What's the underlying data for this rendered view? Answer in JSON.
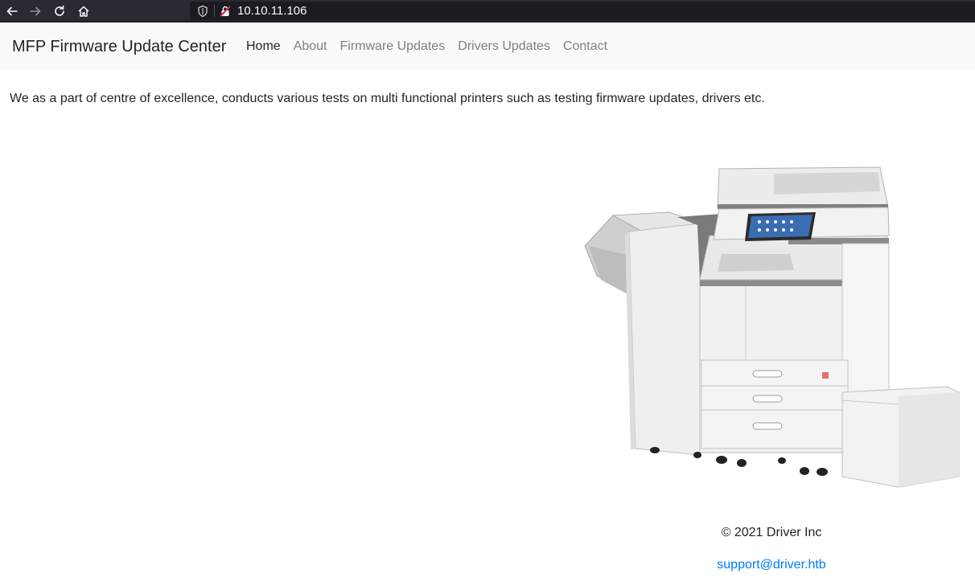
{
  "browser": {
    "url": "10.10.11.106",
    "icons": [
      "back-icon",
      "forward-icon",
      "reload-icon",
      "home-icon",
      "shield-icon",
      "insecure-lock-icon"
    ]
  },
  "navbar": {
    "brand": "MFP Firmware Update Center",
    "links": [
      {
        "label": "Home"
      },
      {
        "label": "About"
      },
      {
        "label": "Firmware Updates"
      },
      {
        "label": "Drivers Updates"
      },
      {
        "label": "Contact"
      }
    ]
  },
  "main": {
    "intro": "We as a part of centre of excellence, conducts various tests on multi functional printers such as testing firmware updates, drivers etc."
  },
  "footer": {
    "copyright": "© 2021 Driver Inc",
    "email": "support@driver.htb"
  },
  "colors": {
    "link": "#007bff",
    "nav_active": "#212529",
    "nav_muted": "#7f7f7f",
    "navbar_bg": "#f8f9fa"
  }
}
